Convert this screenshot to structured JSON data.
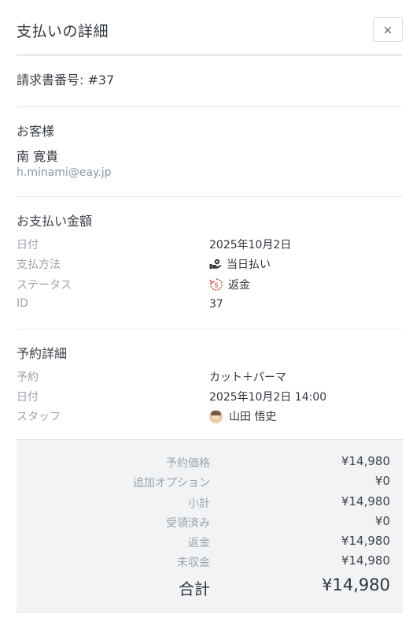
{
  "header": {
    "title": "支払いの詳細",
    "close_label": "×"
  },
  "invoice": {
    "text": "請求書番号: #37"
  },
  "customer": {
    "section_title": "お客様",
    "name": "南 寛貴",
    "email": "h.minami@eay.jp"
  },
  "payment": {
    "section_title": "お支払い金額",
    "rows": [
      {
        "label": "日付",
        "value": "2025年10月2日"
      },
      {
        "label": "支払方法",
        "value": "当日払い",
        "icon": "hand-coin-icon"
      },
      {
        "label": "ステータス",
        "value": "返金",
        "icon": "refund-icon"
      },
      {
        "label": "ID",
        "value": "37"
      }
    ]
  },
  "booking": {
    "section_title": "予約詳細",
    "rows": [
      {
        "label": "予約",
        "value": "カット＋パーマ"
      },
      {
        "label": "日付",
        "value": "2025年10月2日 14:00"
      },
      {
        "label": "スタッフ",
        "value": "山田 悟史",
        "icon": "avatar"
      }
    ]
  },
  "summary": {
    "rows": [
      {
        "label": "予約価格",
        "value": "¥14,980"
      },
      {
        "label": "追加オプション",
        "value": "¥0"
      },
      {
        "label": "小計",
        "value": "¥14,980"
      },
      {
        "label": "受領済み",
        "value": "¥0"
      },
      {
        "label": "返金",
        "value": "¥14,980"
      },
      {
        "label": "未収金",
        "value": "¥14,980"
      }
    ],
    "total_label": "合計",
    "total_value": "¥14,980"
  },
  "colors": {
    "refund_accent": "#e0563b",
    "muted_text": "#9aa3ad",
    "summary_bg": "#f1f3f5"
  }
}
